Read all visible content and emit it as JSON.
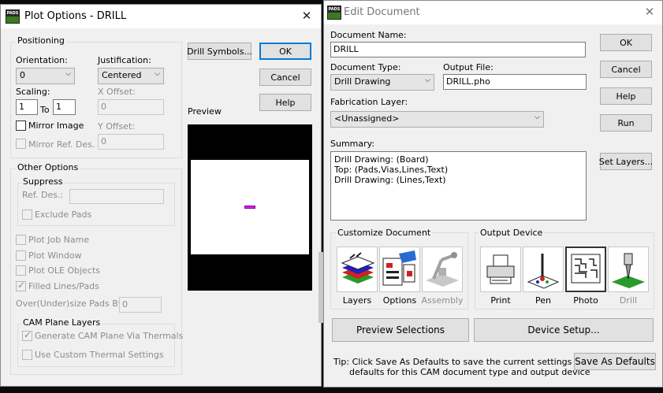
{
  "plot_options": {
    "title": "Plot Options - DRILL",
    "app_icon_text": "PADS",
    "positioning": {
      "group_label": "Positioning",
      "orientation_label": "Orientation:",
      "orientation_value": "0",
      "justification_label": "Justification:",
      "justification_value": "Centered",
      "scaling_label": "Scaling:",
      "scale_from": "1",
      "to_label": "To",
      "scale_to": "1",
      "x_offset_label": "X Offset:",
      "x_offset_value": "0",
      "y_offset_label": "Y Offset:",
      "y_offset_value": "0",
      "mirror_image_label": "Mirror Image",
      "mirror_ref_label": "Mirror Ref. Des."
    },
    "buttons": {
      "drill_symbols": "Drill Symbols...",
      "ok": "OK",
      "cancel": "Cancel",
      "help": "Help"
    },
    "preview_label": "Preview",
    "other_options": {
      "group_label": "Other Options",
      "suppress_label": "Suppress",
      "ref_des_label": "Ref. Des.:",
      "exclude_pads_label": "Exclude Pads",
      "plot_job_name": "Plot Job Name",
      "plot_window": "Plot Window",
      "plot_ole_objects": "Plot OLE Objects",
      "filled_lines_pads": "Filled Lines/Pads",
      "oversize_label": "Over(Under)size Pads By:",
      "oversize_value": "0",
      "cam_plane_label": "CAM Plane Layers",
      "generate_cam": "Generate CAM Plane Via Thermals",
      "use_custom_thermal": "Use Custom Thermal Settings"
    }
  },
  "edit_document": {
    "title": "Edit Document",
    "doc_name_label": "Document Name:",
    "doc_name_value": "DRILL",
    "doc_type_label": "Document Type:",
    "doc_type_value": "Drill Drawing",
    "output_file_label": "Output File:",
    "output_file_value": "DRILL.pho",
    "fab_layer_label": "Fabrication Layer:",
    "fab_layer_value": "<Unassigned>",
    "summary_label": "Summary:",
    "summary_lines": [
      "Drill Drawing: (Board)",
      "Top: (Pads,Vias,Lines,Text)",
      "Drill Drawing: (Lines,Text)"
    ],
    "buttons": {
      "ok": "OK",
      "cancel": "Cancel",
      "help": "Help",
      "run": "Run",
      "set_layers": "Set Layers...",
      "preview_selections": "Preview Selections",
      "device_setup": "Device Setup...",
      "save_defaults": "Save As Defaults"
    },
    "customize_label": "Customize Document",
    "customize_items": [
      "Layers",
      "Options",
      "Assembly"
    ],
    "output_device_label": "Output Device",
    "device_items": [
      "Print",
      "Pen",
      "Photo",
      "Drill"
    ],
    "tip_line1": "Tip: Click Save As Defaults to save the current settings as the",
    "tip_line2": "defaults for this CAM document type and output device"
  }
}
